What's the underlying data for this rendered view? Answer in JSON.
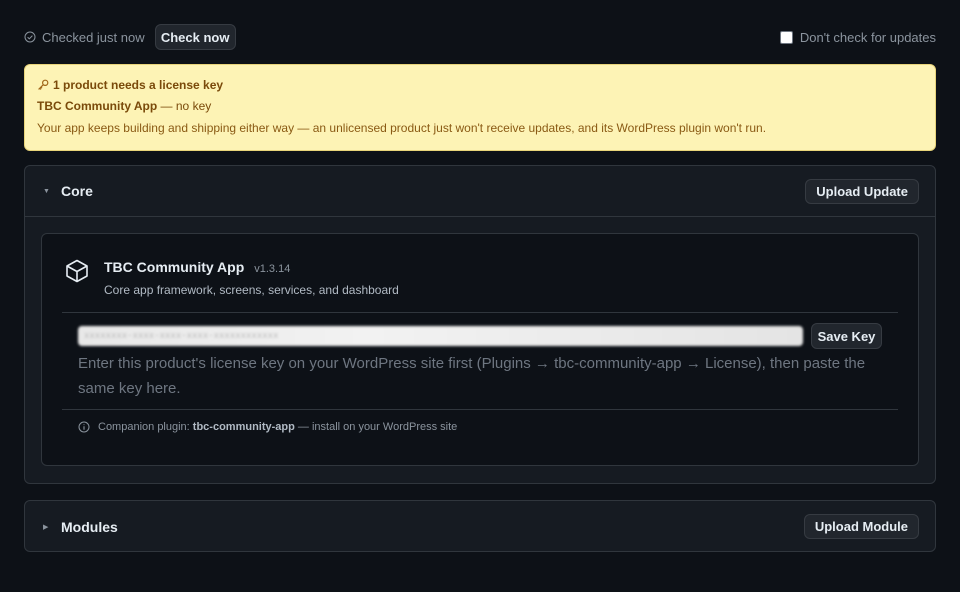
{
  "topbar": {
    "checked_text": "Checked just now",
    "check_button": "Check now",
    "dont_check_label": "Don't check for updates",
    "dont_check_checked": false
  },
  "banner": {
    "title": "1 product needs a license key",
    "product_name": "TBC Community App",
    "product_status": " — no key",
    "message": "Your app keeps building and shipping either way — an unlicensed product just won't receive updates, and its WordPress plugin won't run."
  },
  "core": {
    "title": "Core",
    "upload_button": "Upload Update",
    "product": {
      "name": "TBC Community App",
      "version": "v1.3.14",
      "description": "Core app framework, screens, services, and dashboard",
      "key_value": "xxxxxxxx-xxxx-xxxx-xxxx-xxxxxxxxxxxx",
      "save_button": "Save Key",
      "hint": "Enter this product's license key on your WordPress site first (Plugins → tbc-community-app → License), then paste the same key here.",
      "companion_prefix": "Companion plugin: ",
      "companion_plugin": "tbc-community-app",
      "companion_suffix": " — install on your WordPress site"
    }
  },
  "modules": {
    "title": "Modules",
    "upload_button": "Upload Module"
  },
  "colors": {
    "background": "#0d1117",
    "panel": "#161b22",
    "banner_bg": "#fdf3b5",
    "banner_text": "#7a4a0a"
  },
  "icons": {
    "checked": "check-circle-icon",
    "key": "key-icon",
    "collapse_open": "triangle-down-icon",
    "collapse_closed": "triangle-right-icon",
    "product": "box-icon",
    "info": "info-icon"
  }
}
